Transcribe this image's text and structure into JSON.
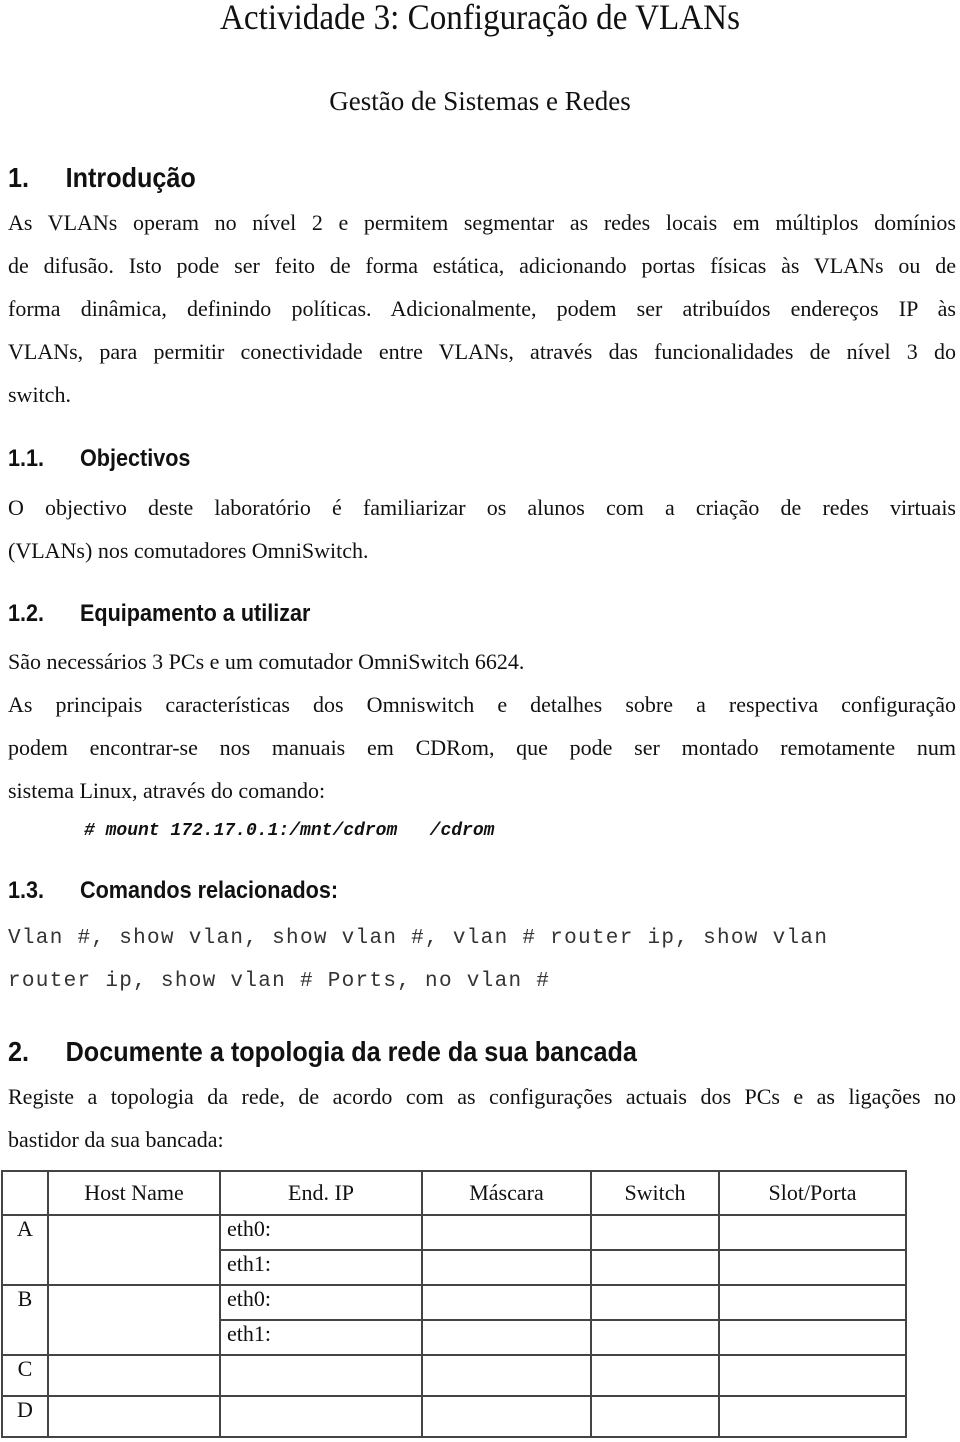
{
  "header": {
    "title": "Actividade 3: Configuração de VLANs",
    "subtitle": "Gestão de Sistemas e Redes"
  },
  "sections": {
    "intro": {
      "number": "1.",
      "title": "Introdução",
      "lines": [
        "As VLANs operam no nível 2 e permitem segmentar as redes locais em múltiplos domínios",
        "de difusão. Isto pode ser feito de forma estática, adicionando portas físicas às VLANs ou de",
        "forma dinâmica, definindo políticas. Adicionalmente, podem ser atribuídos endereços IP às",
        "VLANs, para permitir conectividade entre VLANs, através das funcionalidades de nível 3 do",
        "switch."
      ]
    },
    "objectivos": {
      "number": "1.1.",
      "title": "Objectivos",
      "lines": [
        "O objectivo deste laboratório é familiarizar os alunos com a criação de redes virtuais",
        "(VLANs) nos comutadores OmniSwitch."
      ]
    },
    "equipamento": {
      "number": "1.2.",
      "title": "Equipamento a utilizar",
      "lines": [
        "São necessários 3 PCs e um comutador OmniSwitch 6624.",
        "As principais características dos Omniswitch e detalhes sobre a respectiva configuração",
        "podem encontrar-se nos manuais em CDRom, que pode ser montado remotamente num",
        "sistema Linux, através do comando:"
      ],
      "command": "# mount 172.17.0.1:/mnt/cdrom   /cdrom"
    },
    "comandos": {
      "number": "1.3.",
      "title": "Comandos relacionados:",
      "lines": [
        "Vlan #, show vlan, show vlan #, vlan # router ip, show vlan",
        "router ip, show vlan # Ports, no vlan #"
      ]
    },
    "topologia": {
      "number": "2.",
      "title": "Documente a topologia da rede da sua bancada",
      "lines": [
        "Registe a topologia da rede, de acordo com as configurações actuais dos PCs e as ligações no",
        "bastidor da sua bancada:"
      ]
    }
  },
  "table": {
    "headers": [
      "",
      "Host Name",
      "End. IP",
      "Máscara",
      "Switch",
      "Slot/Porta"
    ],
    "rows": [
      {
        "label": "A",
        "host": "",
        "ip": [
          "eth0:",
          "eth1:"
        ]
      },
      {
        "label": "B",
        "host": "",
        "ip": [
          "eth0:",
          "eth1:"
        ]
      },
      {
        "label": "C",
        "host": "",
        "ip": [
          ""
        ]
      },
      {
        "label": "D",
        "host": "",
        "ip": [
          ""
        ]
      }
    ]
  }
}
